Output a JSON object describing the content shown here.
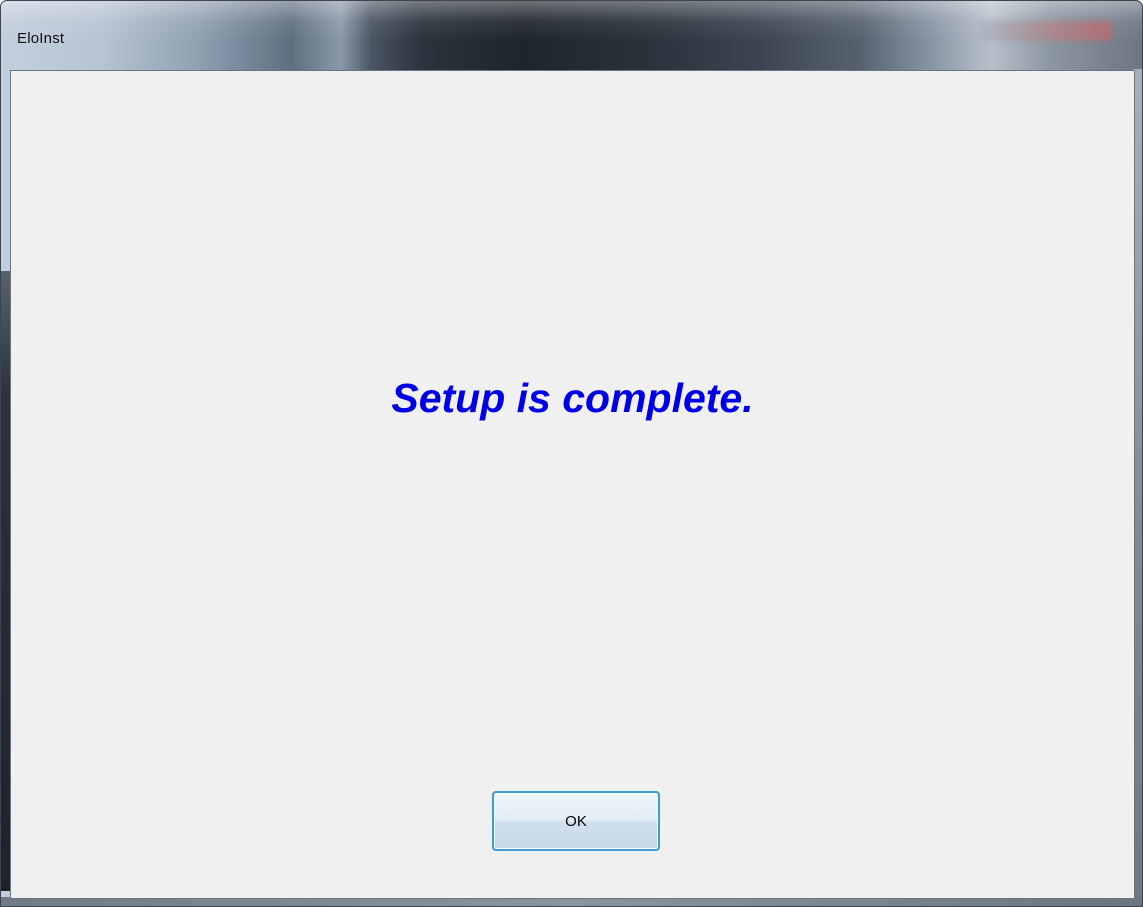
{
  "window": {
    "title": "EloInst"
  },
  "dialog": {
    "message": "Setup is complete.",
    "message_color": "#0000e6",
    "ok_label": "OK"
  }
}
